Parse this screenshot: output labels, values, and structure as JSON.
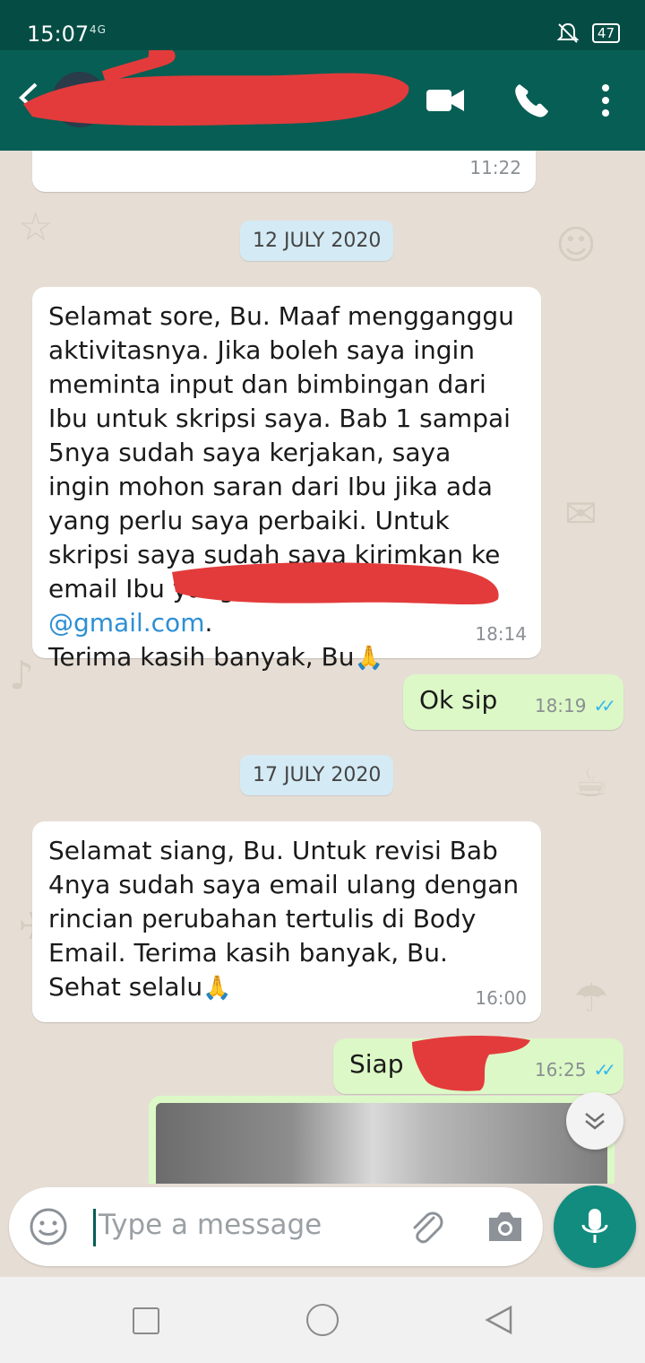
{
  "status_bar": {
    "time": "15:07",
    "network": "4G",
    "battery": "47"
  },
  "header": {
    "contact_name": ""
  },
  "chat": {
    "top_message": {
      "time": "11:22"
    },
    "date_1": "12 JULY 2020",
    "msg_1": {
      "line_1": "Selamat sore, Bu. Maaf mengganggu aktivitasnya. Jika boleh saya ingin meminta input dan bimbingan dari Ibu untuk skripsi saya. Bab 1 sampai 5nya sudah saya kerjakan, saya ingin mohon saran dari Ibu jika ada yang perlu saya perbaiki. Untuk skripsi saya sudah saya kirimkan ke email Ibu yang ",
      "link": "e",
      "link_end": "@gmail.com",
      "after_link": ".",
      "line_last": "Terima kasih banyak, Bu",
      "emoji": "🙏",
      "time": "18:14"
    },
    "msg_2": {
      "text": "Ok sip",
      "time": "18:19"
    },
    "date_2": "17 JULY 2020",
    "msg_3": {
      "text": "Selamat siang, Bu. Untuk revisi Bab 4nya sudah saya email ulang dengan rincian perubahan tertulis di Body Email. Terima kasih banyak, Bu. Sehat selalu",
      "emoji": "🙏",
      "time": "16:00"
    },
    "msg_4": {
      "text": "Siap",
      "time": "16:25"
    }
  },
  "input": {
    "placeholder": "Type a message"
  },
  "colors": {
    "header": "#075e54",
    "status": "#054d44",
    "outgoing": "#dcf8c6",
    "incoming": "#ffffff",
    "date_chip": "#d4eaf4",
    "mic": "#128c7e",
    "ticks": "#34b7f1"
  }
}
